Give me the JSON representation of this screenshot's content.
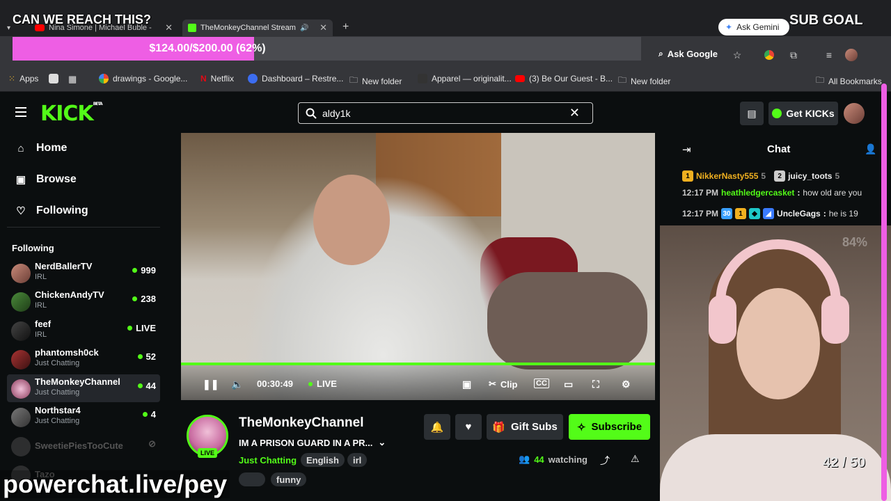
{
  "overlay": {
    "goal_heading": "CAN WE REACH THIS?",
    "goal_text": "$124.00/$200.00 (62%)",
    "goal_progress": 0.62,
    "sub_goal_heading": "SUB GOAL",
    "sub_count": "42 / 50",
    "sub_pct_watermark": "84%",
    "watermark": "powerchat.live/pey"
  },
  "browser": {
    "tabs": [
      {
        "title": "Nina Simone | Michael Buble -",
        "active": false
      },
      {
        "title": "TheMonkeyChannel Stream",
        "active": true
      }
    ],
    "new_tab": "+",
    "ask_gemini": "Ask Gemini",
    "ask_google": "Ask Google",
    "bookmarks": [
      {
        "label": "Apps",
        "color": "#e9b22c"
      },
      {
        "label": "drawings - Google...",
        "color": "#ffffff"
      },
      {
        "label": "Netflix",
        "color": "#e50914"
      },
      {
        "label": "Dashboard – Restre...",
        "color": "#3c6df0"
      },
      {
        "label": "New folder",
        "color": "#cccccc"
      },
      {
        "label": "Apparel — originalit...",
        "color": "#333333"
      },
      {
        "label": "(3) Be Our Guest - B...",
        "color": "#ff0000"
      },
      {
        "label": "New folder",
        "color": "#cccccc"
      }
    ],
    "all_bookmarks": "All Bookmarks"
  },
  "kick": {
    "logo": "KICK",
    "logo_beta": "BETA",
    "search_value": "aldy1k",
    "get_kicks": "Get KICKs",
    "accent": "#53fc18",
    "nav": [
      {
        "label": "Home",
        "icon": "home-icon"
      },
      {
        "label": "Browse",
        "icon": "browse-icon"
      },
      {
        "label": "Following",
        "icon": "heart-icon"
      }
    ],
    "following_heading": "Following",
    "channels": [
      {
        "name": "NerdBallerTV",
        "category": "IRL",
        "viewers": "999",
        "active": false
      },
      {
        "name": "ChickenAndyTV",
        "category": "IRL",
        "viewers": "238",
        "active": false
      },
      {
        "name": "feef",
        "category": "IRL",
        "viewers": "LIVE",
        "active": false
      },
      {
        "name": "phantomsh0ck",
        "category": "Just Chatting",
        "viewers": "52",
        "active": false
      },
      {
        "name": "TheMonkeyChannel",
        "category": "Just Chatting",
        "viewers": "44",
        "active": true
      },
      {
        "name": "Northstar4",
        "category": "Just Chatting",
        "viewers": "4",
        "active": false
      },
      {
        "name": "SweetiePiesTooCute",
        "category": "",
        "viewers": "",
        "active": false
      },
      {
        "name": "Tazo",
        "category": "",
        "viewers": "",
        "active": false
      }
    ],
    "player": {
      "time": "00:30:49",
      "live_label": "LIVE",
      "clip_label": "Clip"
    },
    "stream": {
      "channel_name": "TheMonkeyChannel",
      "live_badge": "LIVE",
      "title": "IM A PRISON GUARD IN A PR...",
      "category": "Just Chatting",
      "tags": [
        "English",
        "irl",
        "",
        "funny"
      ],
      "gift_subs": "Gift Subs",
      "subscribe": "Subscribe",
      "watching_count": "44",
      "watching_label": "watching"
    },
    "chat": {
      "title": "Chat",
      "top_gifters": [
        {
          "name": "NikkerNasty555",
          "count": "5",
          "rank": "1"
        },
        {
          "name": "juicy_toots",
          "count": "5",
          "rank": "2"
        }
      ],
      "messages": [
        {
          "time": "12:17 PM",
          "user": "heathledgercasket",
          "text": "how old are you"
        },
        {
          "time": "12:17 PM",
          "user": "UncleGags",
          "text": "he is 19",
          "badge": "30"
        }
      ]
    }
  }
}
